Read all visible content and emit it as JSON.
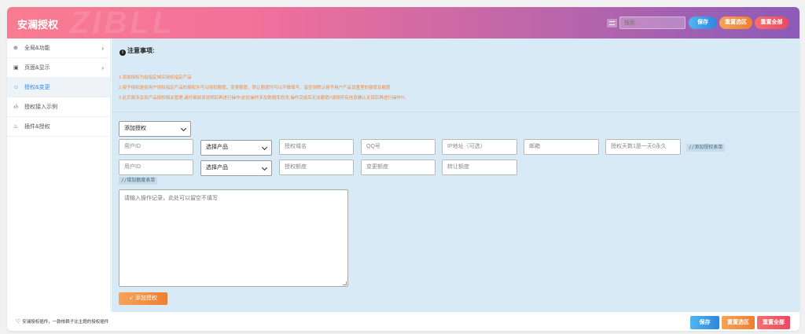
{
  "header": {
    "title": "安澜授权",
    "watermark": "ZIBLL",
    "search_placeholder": "搜索...",
    "save_label": "保存",
    "reset_section_label": "重置选区",
    "reset_all_label": "重置全部"
  },
  "sidebar": {
    "items": [
      {
        "label": "全局&功能",
        "icon": "globe-icon",
        "arrow": "›"
      },
      {
        "label": "页面&显示",
        "icon": "calendar-icon",
        "arrow": "›"
      },
      {
        "label": "授权&变更",
        "icon": "smile-icon",
        "arrow": ""
      },
      {
        "label": "授权接入示例",
        "icon": "code-icon",
        "arrow": ""
      },
      {
        "label": "插件&授权",
        "icon": "plugin-icon",
        "arrow": ""
      }
    ]
  },
  "notice": {
    "title": "注意事项:",
    "lines": [
      "1.添加授权为给指定域名授权指定产品",
      "2.授予授权是给用户授权指定产品的授权许可以授权额度，变更额度，转让额度均可以不做填写，留空则默认授予用户产品设置里的额度及额度",
      "3.此页面涉及到产品授权相关管理,请仔细阅读说明后再进行操作!此处操作涉及数据库修改,操作完成后无法撤销!!请将所有信息确认无误后再进行操作!!!。"
    ]
  },
  "form": {
    "action_select": "添加授权",
    "row1": {
      "user_id": "用户ID",
      "product_select": "选择产品",
      "domain": "授权域名",
      "qq": "QQ号",
      "ip": "IP地址（可选）",
      "email": "邮箱",
      "days": "授权天数1是一天0永久",
      "hint": "//添加授权表单"
    },
    "row2": {
      "user_id": "用户ID",
      "product_select": "选择产品",
      "quota": "授权额度",
      "change_quota": "变更额度",
      "transfer_quota": "转让额度",
      "hint": "//增加额度表单"
    },
    "note_placeholder": "请输入操作记录，此处可以留空不填写",
    "submit_label": "添加授权"
  },
  "footer": {
    "text": "安澜授权插件，一款依赖子比主题的授权插件",
    "save_label": "保存",
    "reset_section_label": "重置选区",
    "reset_all_label": "重置全部"
  },
  "colors": {
    "header_gradient_start": "#f87c91",
    "header_gradient_end": "#8c5bb8",
    "content_bg": "#d8eaf5",
    "notice_text": "#ee8a45",
    "active_nav": "#3a8ee6"
  }
}
